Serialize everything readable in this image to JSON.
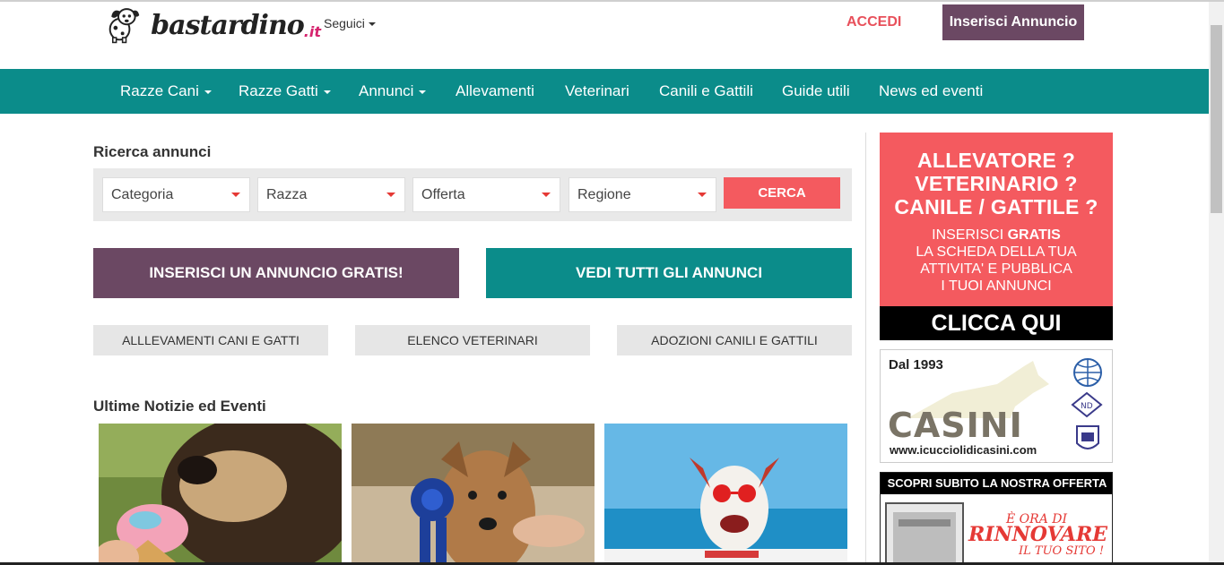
{
  "header": {
    "logo_text": "bastardino",
    "logo_tld": ".it",
    "seguici_label": "Seguici",
    "accedi_label": "ACCEDI",
    "insert_button_label": "Inserisci Annuncio"
  },
  "nav": {
    "items": [
      {
        "label": "Razze Cani",
        "dropdown": true
      },
      {
        "label": "Razze Gatti",
        "dropdown": true
      },
      {
        "label": "Annunci",
        "dropdown": true
      },
      {
        "label": "Allevamenti",
        "dropdown": false
      },
      {
        "label": "Veterinari",
        "dropdown": false
      },
      {
        "label": "Canili e Gattili",
        "dropdown": false
      },
      {
        "label": "Guide utili",
        "dropdown": false
      },
      {
        "label": "News ed eventi",
        "dropdown": false
      }
    ]
  },
  "search": {
    "title": "Ricerca annunci",
    "selects": [
      "Categoria",
      "Razza",
      "Offerta",
      "Regione"
    ],
    "button_label": "CERCA"
  },
  "cta": {
    "insert_label": "INSERISCI UN ANNUNCIO GRATIS!",
    "view_all_label": "VEDI TUTTI GLI ANNUNCI"
  },
  "quick_links": [
    "ALLLEVAMENTI CANI E GATTI",
    "ELENCO VETERINARI",
    "ADOZIONI CANILI E GATTILI"
  ],
  "news": {
    "title": "Ultime Notizie ed Eventi"
  },
  "sidebar": {
    "ad1": {
      "lines": [
        "ALLEVATORE ?",
        "VETERINARIO ?",
        "CANILE / GATTILE ?"
      ],
      "sub_prefix": "INSERISCI ",
      "sub_bold": "GRATIS",
      "sub_lines": [
        "LA SCHEDA DELLA TUA",
        "ATTIVITA' E PUBBLICA",
        "I TUOI ANNUNCI"
      ],
      "cta": "CLICCA QUI"
    },
    "ad2": {
      "year": "Dal 1993",
      "name": "CASINI",
      "url": "www.icucciolidicasini.com"
    },
    "ad3": {
      "bar": "SCOPRI SUBITO LA NOSTRA OFFERTA",
      "line1": "È ORA DI",
      "line2": "RINNOVARE",
      "line3": "IL TUO SITO !"
    }
  },
  "colors": {
    "teal": "#0b8c8a",
    "plum": "#6b4863",
    "coral": "#f45a5f",
    "accedi": "#e8505b"
  }
}
